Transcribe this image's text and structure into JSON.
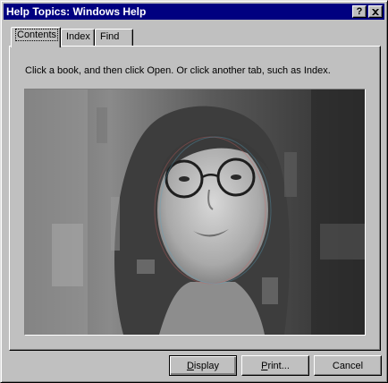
{
  "window": {
    "title": "Help Topics: Windows Help",
    "help_button": "?",
    "close_button": "X"
  },
  "tabs": [
    {
      "label": "Contents",
      "active": true
    },
    {
      "label": "Index",
      "active": false
    },
    {
      "label": "Find",
      "active": false
    }
  ],
  "panel": {
    "instruction": "Click a book, and then click Open. Or click another tab, such as Index."
  },
  "buttons": {
    "display": {
      "label": "Display",
      "mnemonic": "D",
      "rest": "isplay"
    },
    "print": {
      "label": "Print...",
      "mnemonic": "P",
      "rest": "rint..."
    },
    "cancel": {
      "label": "Cancel"
    }
  }
}
